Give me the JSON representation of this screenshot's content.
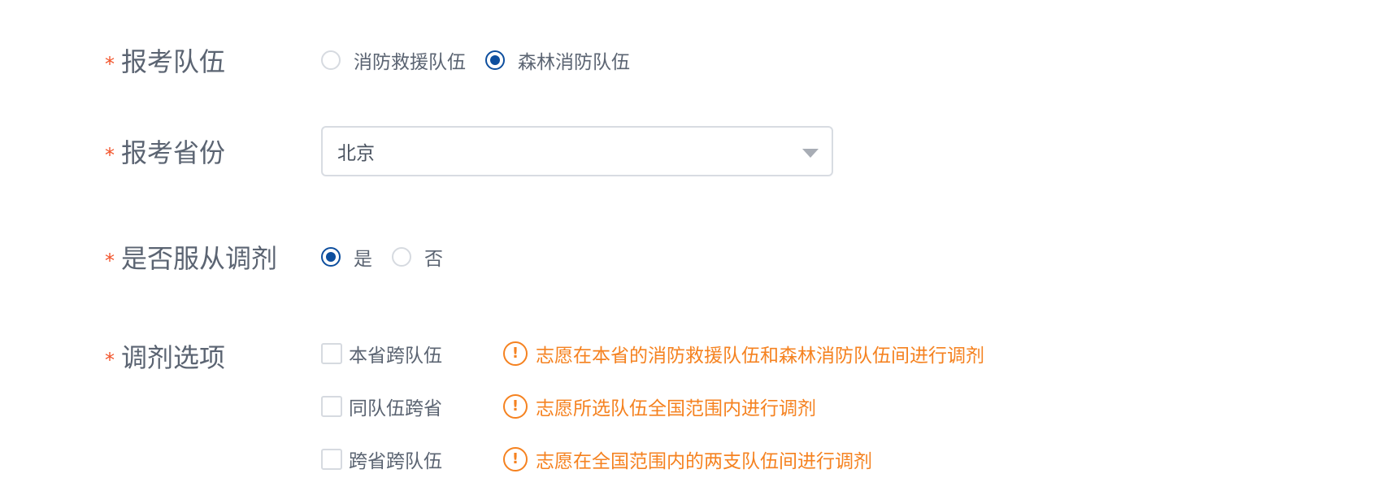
{
  "team": {
    "label": "报考队伍",
    "required_mark": "*",
    "options": [
      {
        "label": "消防救援队伍",
        "checked": false
      },
      {
        "label": "森林消防队伍",
        "checked": true
      }
    ]
  },
  "province": {
    "label": "报考省份",
    "required_mark": "*",
    "value": "北京"
  },
  "obey_adjust": {
    "label": "是否服从调剂",
    "required_mark": "*",
    "options": [
      {
        "label": "是",
        "checked": true
      },
      {
        "label": "否",
        "checked": false
      }
    ]
  },
  "adjust_options": {
    "label": "调剂选项",
    "required_mark": "*",
    "items": [
      {
        "label": "本省跨队伍",
        "checked": false,
        "hint": "志愿在本省的消防救援队伍和森林消防队伍间进行调剂"
      },
      {
        "label": "同队伍跨省",
        "checked": false,
        "hint": "志愿所选队伍全国范围内进行调剂"
      },
      {
        "label": "跨省跨队伍",
        "checked": false,
        "hint": "志愿在全国范围内的两支队伍间进行调剂"
      }
    ],
    "hint_icon_glyph": "!"
  },
  "colors": {
    "required": "#f2542b",
    "accent": "#0d4e9e",
    "warning": "#f58220",
    "label": "#5b6472"
  },
  "icons": {
    "select_caret": "caret-down-icon",
    "hint": "exclamation-circle-icon"
  }
}
